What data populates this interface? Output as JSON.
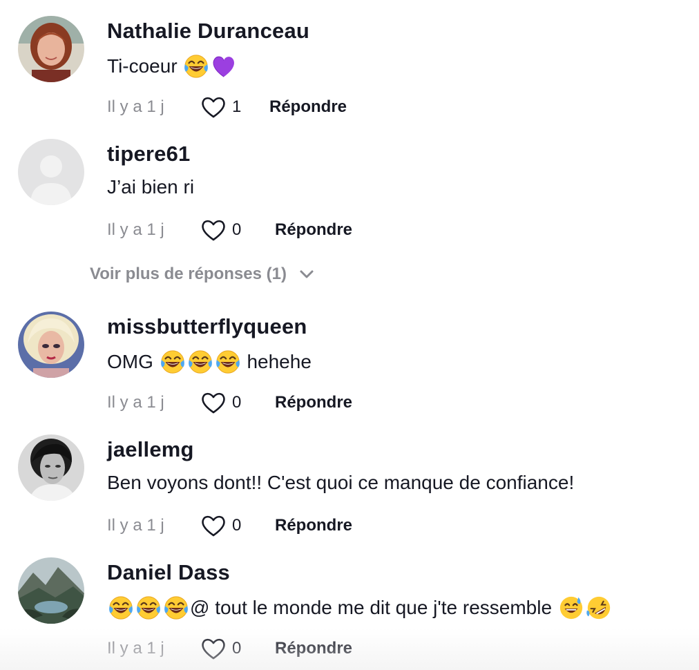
{
  "comments": [
    {
      "username": "Nathalie Duranceau",
      "text_before": "Ti-coeur ",
      "emojis": [
        "face-with-tears-of-joy-emoji",
        "purple-heart-emoji"
      ],
      "text_after": "",
      "time": "Il y a 1 j",
      "likes": "1",
      "reply_label": "Répondre",
      "avatar": "profile-photo-woman-red-hair"
    },
    {
      "username": "tipere61",
      "text_before": "J’ai bien ri",
      "emojis": [],
      "text_after": "",
      "time": "Il y a 1 j",
      "likes": "0",
      "reply_label": "Répondre",
      "avatar": "default-avatar"
    },
    {
      "username": "missbutterflyqueen",
      "text_before": "OMG ",
      "emojis": [
        "face-with-tears-of-joy-emoji",
        "face-with-tears-of-joy-emoji",
        "face-with-tears-of-joy-emoji"
      ],
      "text_after": " hehehe",
      "time": "Il y a 1 j",
      "likes": "0",
      "reply_label": "Répondre",
      "avatar": "profile-photo-blonde-drag-queen"
    },
    {
      "username": "jaellemg",
      "text_before": "Ben voyons dont!! C'est quoi ce manque de confiance!",
      "emojis": [],
      "text_after": "",
      "time": "Il y a 1 j",
      "likes": "0",
      "reply_label": "Répondre",
      "avatar": "profile-photo-black-and-white-woman"
    },
    {
      "username": "Daniel Dass",
      "text_before": "",
      "emojis": [
        "face-with-tears-of-joy-emoji",
        "face-with-tears-of-joy-emoji",
        "face-with-tears-of-joy-emoji"
      ],
      "text_after": "@ tout le monde me dit que j'te ressemble ",
      "emojis_after": [
        "grinning-face-with-sweat-emoji",
        "rolling-on-floor-laughing-emoji"
      ],
      "time": "Il y a 1 j",
      "likes": "0",
      "reply_label": "Répondre",
      "avatar": "profile-photo-mountain-landscape"
    }
  ],
  "view_more": {
    "label": "Voir plus de réponses (1)",
    "icon": "chevron-down-icon"
  },
  "colors": {
    "text_primary": "#161823",
    "text_secondary": "#8a8b91"
  }
}
